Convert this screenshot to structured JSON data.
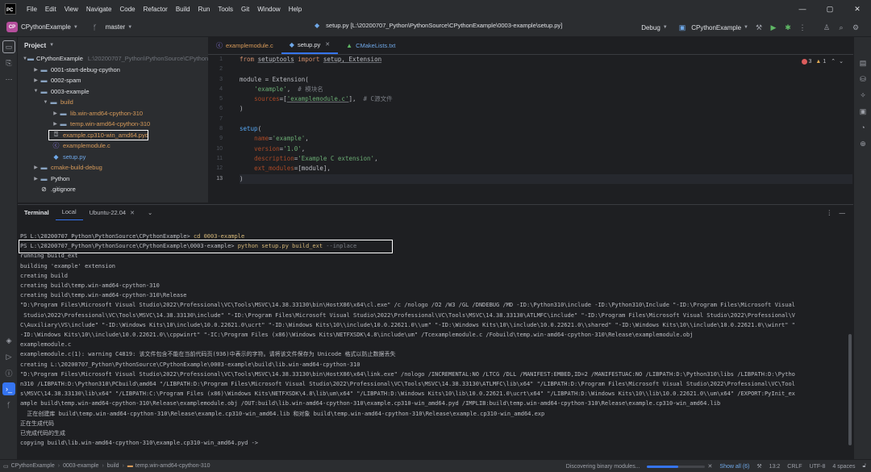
{
  "menu": [
    "File",
    "Edit",
    "View",
    "Navigate",
    "Code",
    "Refactor",
    "Build",
    "Run",
    "Tools",
    "Git",
    "Window",
    "Help"
  ],
  "toolbar": {
    "project_badge": "CP",
    "project_name": "CPythonExample",
    "branch": "master",
    "current_file": "setup.py [L:\\20200707_Python\\PythonSource\\CPythonExample\\0003-example\\setup.py]",
    "run_config": "Debug",
    "run_target": "CPythonExample"
  },
  "project_panel": {
    "title": "Project",
    "items": [
      {
        "label": "CPythonExample",
        "hint": "L:\\20200707_Python\\PythonSource\\CPythonExample"
      },
      {
        "label": "0001-start-debug-cpython"
      },
      {
        "label": "0002-spam"
      },
      {
        "label": "0003-example"
      },
      {
        "label": "build"
      },
      {
        "label": "lib.win-amd64-cpython-310"
      },
      {
        "label": "temp.win-amd64-cpython-310"
      },
      {
        "label": "example.cp310-win_amd64.pyd"
      },
      {
        "label": "examplemodule.c"
      },
      {
        "label": "setup.py"
      },
      {
        "label": "cmake-build-debug"
      },
      {
        "label": "Python"
      },
      {
        "label": ".gitignore"
      }
    ]
  },
  "editor_tabs": [
    {
      "label": "examplemodule.c"
    },
    {
      "label": "setup.py"
    },
    {
      "label": "CMakeLists.txt"
    }
  ],
  "inspections": {
    "errors": "3",
    "warnings": "1"
  },
  "code": {
    "line_numbers": [
      "1",
      "2",
      "3",
      "4",
      "5",
      "6",
      "7",
      "8",
      "9",
      "10",
      "11",
      "12",
      "13"
    ],
    "l1": {
      "from": "from",
      "mod": "setuptools",
      "import": "import",
      "names": "setup, Extension"
    },
    "l3": {
      "text": "module = Extension("
    },
    "l4": {
      "str": "'example'",
      "cmt": "# 模块名"
    },
    "l5": {
      "param": "sources",
      "str": "'examplemodule.c'",
      "cmt": "# C源文件"
    },
    "l6": {
      "text": ")"
    },
    "l8": {
      "fn": "setup",
      "rest": "("
    },
    "l9": {
      "param": "name",
      "str": "'example'"
    },
    "l10": {
      "param": "version",
      "str": "'1.0'"
    },
    "l11": {
      "param": "description",
      "str": "'Example C extension'"
    },
    "l12": {
      "param": "ext_modules",
      "rest": "=[module],"
    },
    "l13": {
      "text": ")"
    }
  },
  "terminal": {
    "tabs": [
      "Terminal",
      "Local",
      "Ubuntu-22.04"
    ],
    "prompt1": "PS L:\\20200707_Python\\PythonSource\\CPythonExample> ",
    "cmd1": "cd 0003-example",
    "prompt2": "PS L:\\20200707_Python\\PythonSource\\CPythonExample\\0003-example> ",
    "cmd2": "python setup.py build_ext",
    "cmd2_flag": " --inplace",
    "lines": [
      "running build_ext",
      "building 'example' extension",
      "creating build",
      "creating build\\temp.win-amd64-cpython-310",
      "creating build\\temp.win-amd64-cpython-310\\Release",
      "\"D:\\Program Files\\Microsoft Visual Studio\\2022\\Professional\\VC\\Tools\\MSVC\\14.38.33130\\bin\\HostX86\\x64\\cl.exe\" /c /nologo /O2 /W3 /GL /DNDEBUG /MD -ID:\\Python310\\include -ID:\\Python310\\Include \"-ID:\\Program Files\\Microsoft Visual",
      " Studio\\2022\\Professional\\VC\\Tools\\MSVC\\14.38.33130\\include\" \"-ID:\\Program Files\\Microsoft Visual Studio\\2022\\Professional\\VC\\Tools\\MSVC\\14.38.33130\\ATLMFC\\include\" \"-ID:\\Program Files\\Microsoft Visual Studio\\2022\\Professional\\V",
      "C\\Auxiliary\\VS\\include\" \"-ID:\\Windows Kits\\10\\include\\10.0.22621.0\\ucrt\" \"-ID:\\Windows Kits\\10\\\\include\\10.0.22621.0\\\\um\" \"-ID:\\Windows Kits\\10\\\\include\\10.0.22621.0\\\\shared\" \"-ID:\\Windows Kits\\10\\\\include\\10.0.22621.0\\\\winrt\" \"",
      "-ID:\\Windows Kits\\10\\\\include\\10.0.22621.0\\\\cppwinrt\" \"-IC:\\Program Files (x86)\\Windows Kits\\NETFXSDK\\4.8\\include\\um\" /Tcexamplemodule.c /Fobuild\\temp.win-amd64-cpython-310\\Release\\examplemodule.obj",
      "examplemodule.c",
      "examplemodule.c(1): warning C4819: 该文件包含不能在当前代码页(936)中表示的字符。请将该文件保存为 Unicode 格式以防止数据丢失",
      "creating L:\\20200707_Python\\PythonSource\\CPythonExample\\0003-example\\build\\lib.win-amd64-cpython-310",
      "\"D:\\Program Files\\Microsoft Visual Studio\\2022\\Professional\\VC\\Tools\\MSVC\\14.38.33130\\bin\\HostX86\\x64\\link.exe\" /nologo /INCREMENTAL:NO /LTCG /DLL /MANIFEST:EMBED,ID=2 /MANIFESTUAC:NO /LIBPATH:D:\\Python310\\libs /LIBPATH:D:\\Pytho",
      "n310 /LIBPATH:D:\\Python310\\PCbuild\\amd64 \"/LIBPATH:D:\\Program Files\\Microsoft Visual Studio\\2022\\Professional\\VC\\Tools\\MSVC\\14.38.33130\\ATLMFC\\lib\\x64\" \"/LIBPATH:D:\\Program Files\\Microsoft Visual Studio\\2022\\Professional\\VC\\Tool",
      "s\\MSVC\\14.38.33130\\lib\\x64\" \"/LIBPATH:C:\\Program Files (x86)\\Windows Kits\\NETFXSDK\\4.8\\lib\\um\\x64\" \"/LIBPATH:D:\\Windows Kits\\10\\lib\\10.0.22621.0\\ucrt\\x64\" \"/LIBPATH:D:\\Windows Kits\\10\\\\lib\\10.0.22621.0\\\\um\\x64\" /EXPORT:PyInit_ex",
      "ample build\\temp.win-amd64-cpython-310\\Release\\examplemodule.obj /OUT:build\\lib.win-amd64-cpython-310\\example.cp310-win_amd64.pyd /IMPLIB:build\\temp.win-amd64-cpython-310\\Release\\example.cp310-win_amd64.lib",
      "  正在创建库 build\\temp.win-amd64-cpython-310\\Release\\example.cp310-win_amd64.lib 和对象 build\\temp.win-amd64-cpython-310\\Release\\example.cp310-win_amd64.exp",
      "正在生成代码",
      "已完成代码的生成",
      "copying build\\lib.win-amd64-cpython-310\\example.cp310-win_amd64.pyd ->"
    ]
  },
  "status": {
    "breadcrumbs": [
      "CPythonExample",
      "0003-example",
      "build",
      "temp.win-amd64-cpython-310"
    ],
    "task": "Discovering binary modules...",
    "task_progress": 0.55,
    "show_all": "Show all (6)",
    "position": "13:2",
    "line_sep": "CRLF",
    "encoding": "UTF-8",
    "indent": "4 spaces"
  }
}
